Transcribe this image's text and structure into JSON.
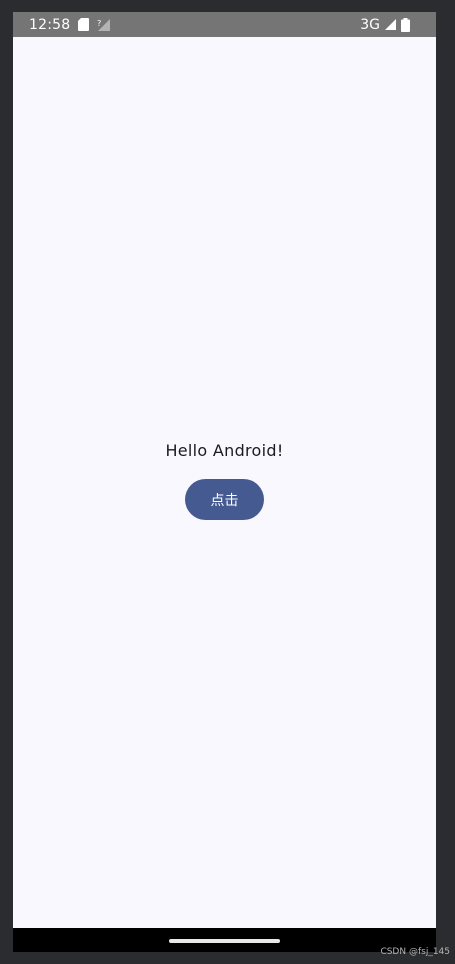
{
  "status_bar": {
    "time": "12:58",
    "network": "3G",
    "icons": [
      "sd-card-icon",
      "no-signal-icon",
      "cell-signal-icon",
      "battery-icon"
    ]
  },
  "main": {
    "greeting": "Hello Android!",
    "button_label": "点击"
  },
  "watermark": "CSDN @fsj_145",
  "colors": {
    "status_bar": "#757575",
    "background": "#f9f8fe",
    "button": "#465a92",
    "nav_bar": "#000000"
  }
}
